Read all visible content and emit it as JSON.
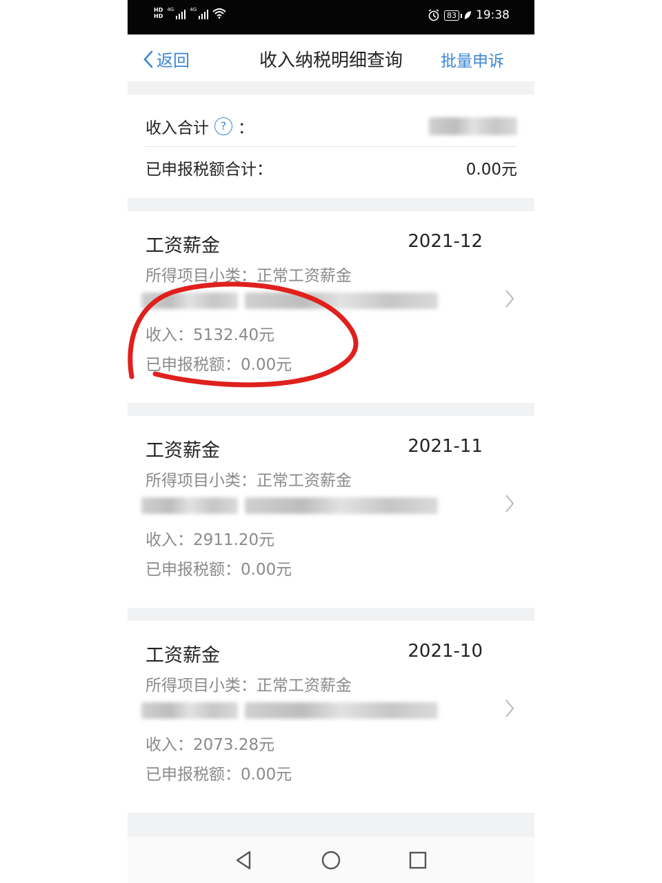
{
  "status_bar": {
    "time": "19:38",
    "battery": "83",
    "hd_top": "HD",
    "hd_bottom": "HD",
    "net1": "4G",
    "net2": "4G",
    "icons": [
      "signal-icon",
      "wifi-icon",
      "alarm-icon",
      "battery-icon",
      "leaf-icon"
    ]
  },
  "nav": {
    "back_label": "返回",
    "title": "收入纳税明细查询",
    "action_label": "批量申诉",
    "accent_color": "#3a86d6"
  },
  "summary": {
    "income_total_label": "收入合计",
    "help_icon_text": "?",
    "income_total_colon": "：",
    "declared_tax_total_label": "已申报税额合计：",
    "declared_tax_total_value": "0.00元"
  },
  "records": [
    {
      "type": "工资薪金",
      "period": "2021-12",
      "subcategory": "所得项目小类：正常工资薪金",
      "income": "收入：5132.40元",
      "declared_tax": "已申报税额：0.00元"
    },
    {
      "type": "工资薪金",
      "period": "2021-11",
      "subcategory": "所得项目小类：正常工资薪金",
      "income": "收入：2911.20元",
      "declared_tax": "已申报税额：0.00元"
    },
    {
      "type": "工资薪金",
      "period": "2021-10",
      "subcategory": "所得项目小类：正常工资薪金",
      "income": "收入：2073.28元",
      "declared_tax": "已申报税额：0.00元"
    }
  ],
  "annotation_color": "#e0201c",
  "system_nav": [
    "back-triangle-icon",
    "home-circle-icon",
    "recents-square-icon"
  ]
}
